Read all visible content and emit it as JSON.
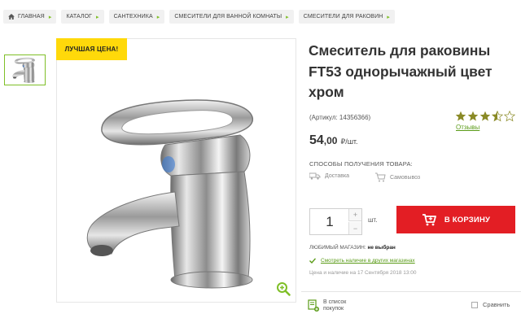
{
  "breadcrumb": [
    {
      "label": "ГЛАВНАЯ",
      "icon": "home-icon"
    },
    {
      "label": "КАТАЛОГ"
    },
    {
      "label": "САНТЕХНИКА"
    },
    {
      "label": "СМЕСИТЕЛИ ДЛЯ ВАННОЙ КОМНАТЫ"
    },
    {
      "label": "СМЕСИТЕЛИ ДЛЯ РАКОВИН"
    }
  ],
  "badge": "ЛУЧШАЯ ЦЕНА!",
  "product": {
    "title": "Смеситель для раковины FT53 однорычажный цвет хром",
    "article": "(Артикул: 14356366)",
    "rating": 3.5,
    "rating_max": 5,
    "reviews_label": "Отзывы",
    "price_main": "54",
    "price_cents": ",00",
    "price_unit": "₽/шт."
  },
  "delivery": {
    "label": "СПОСОБЫ ПОЛУЧЕНИЯ ТОВАРА:",
    "delivery": "Доставка",
    "pickup": "Самовывоз"
  },
  "purchase": {
    "qty": "1",
    "unit": "шт.",
    "cart_label": "В КОРЗИНУ"
  },
  "store": {
    "label": "ЛЮБИМЫЙ МАГАЗИН:",
    "value": "не выбран",
    "check_link": "Смотреть наличие в других магазинах",
    "date_note": "Цена и наличие на 17 Сентября 2018 13:00"
  },
  "actions": {
    "to_list_line1": "В список",
    "to_list_line2": "покупок",
    "compare": "Сравнить"
  },
  "colors": {
    "accent_green": "#7fbf27",
    "badge_yellow": "#ffd90a",
    "cart_red": "#e31e24",
    "star": "#8a8a26"
  }
}
